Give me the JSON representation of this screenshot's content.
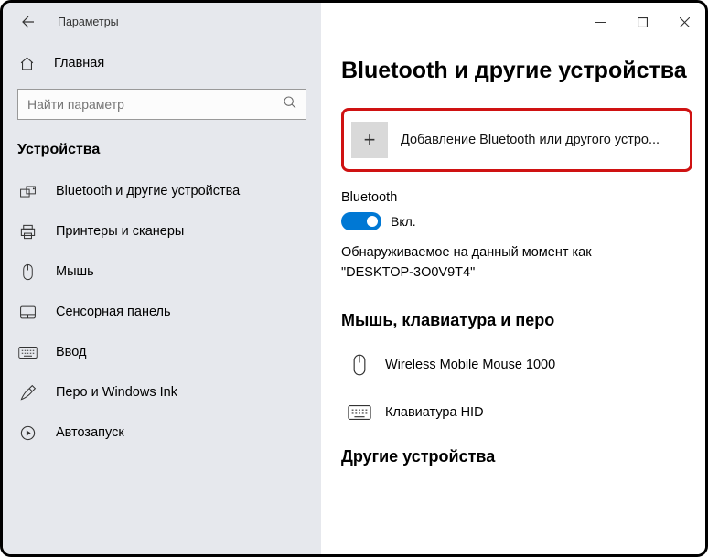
{
  "window": {
    "title": "Параметры"
  },
  "sidebar": {
    "home": "Главная",
    "search_placeholder": "Найти параметр",
    "section": "Устройства",
    "items": [
      {
        "label": "Bluetooth и другие устройства"
      },
      {
        "label": "Принтеры и сканеры"
      },
      {
        "label": "Мышь"
      },
      {
        "label": "Сенсорная панель"
      },
      {
        "label": "Ввод"
      },
      {
        "label": "Перо и Windows Ink"
      },
      {
        "label": "Автозапуск"
      }
    ]
  },
  "content": {
    "page_title": "Bluetooth и другие устройства",
    "add_device_label": "Добавление Bluetooth или другого устро...",
    "bluetooth_label": "Bluetooth",
    "toggle_label": "Вкл.",
    "discover_text": "Обнаруживаемое на данный момент как\n\"DESKTOP-3O0V9T4\"",
    "mouse_section": "Мышь, клавиатура и перо",
    "devices": [
      {
        "label": "Wireless Mobile Mouse 1000"
      },
      {
        "label": "Клавиатура HID"
      }
    ],
    "other_section": "Другие устройства"
  }
}
